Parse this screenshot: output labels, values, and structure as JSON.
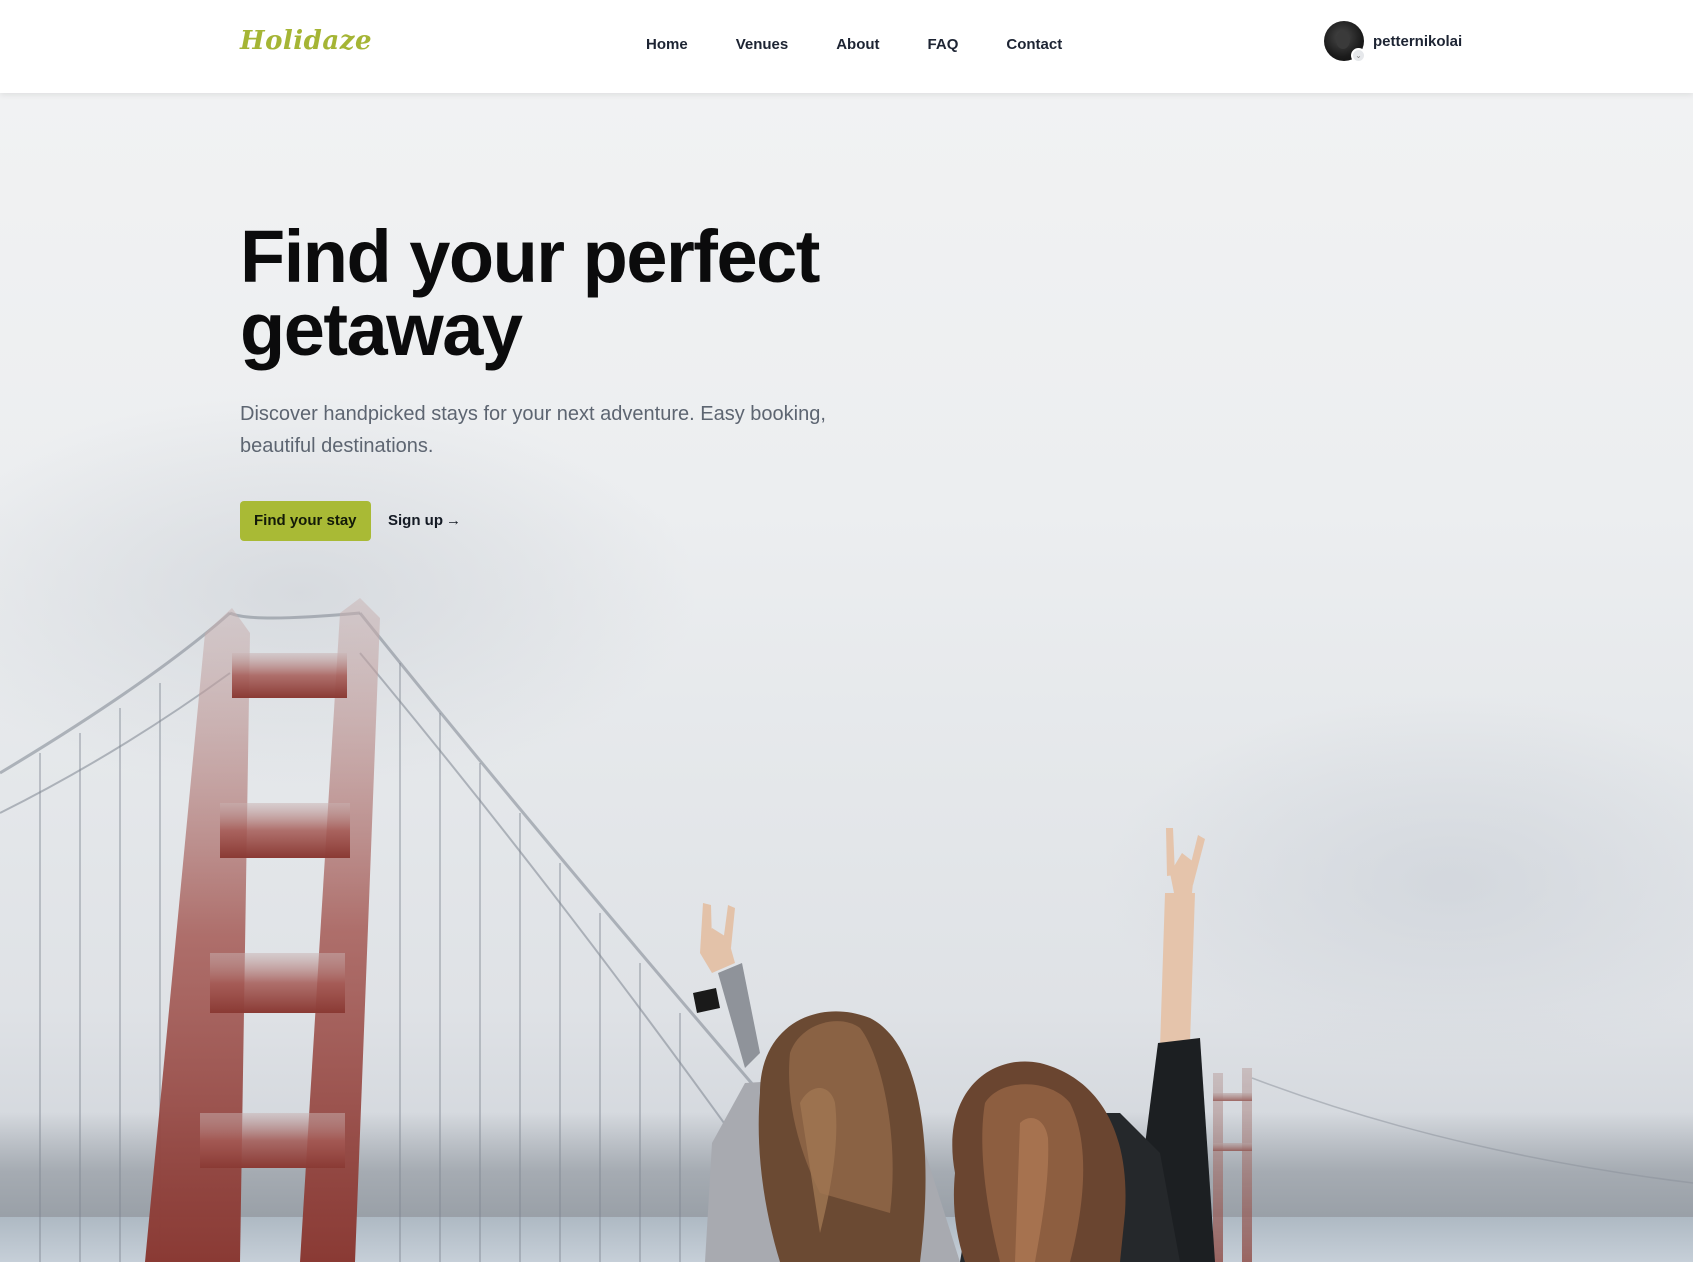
{
  "header": {
    "logo": "Holidaze",
    "nav": [
      "Home",
      "Venues",
      "About",
      "FAQ",
      "Contact"
    ],
    "user": {
      "name": "petternikolai"
    }
  },
  "hero": {
    "title_line1": "Find your perfect",
    "title_line2": "getaway",
    "subtitle_line1": "Discover handpicked stays for your next adventure. Easy booking,",
    "subtitle_line2": "beautiful destinations.",
    "primary_button": "Find your stay",
    "secondary_link": "Sign up",
    "secondary_arrow": "→"
  },
  "colors": {
    "accent": "#a9ba35",
    "logo": "#a5b535",
    "text_dark": "#0b0b0c",
    "text_muted": "#5d6571"
  }
}
